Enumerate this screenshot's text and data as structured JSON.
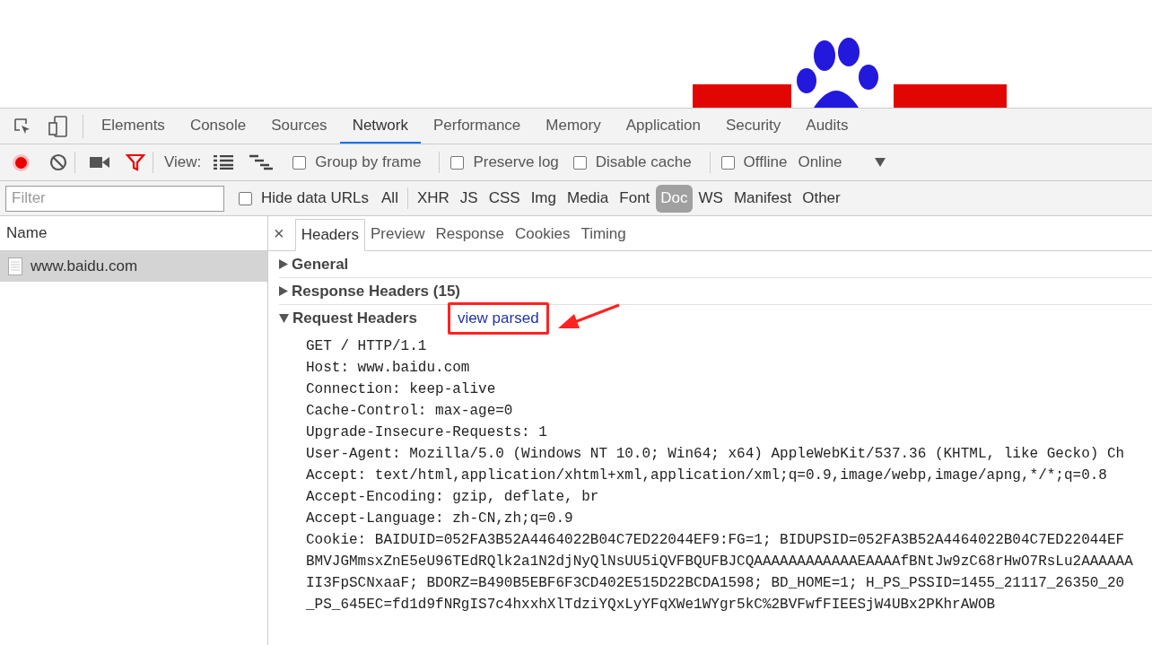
{
  "devtools_tabs": [
    {
      "label": "Elements",
      "selected": false
    },
    {
      "label": "Console",
      "selected": false
    },
    {
      "label": "Sources",
      "selected": false
    },
    {
      "label": "Network",
      "selected": true
    },
    {
      "label": "Performance",
      "selected": false
    },
    {
      "label": "Memory",
      "selected": false
    },
    {
      "label": "Application",
      "selected": false
    },
    {
      "label": "Security",
      "selected": false
    },
    {
      "label": "Audits",
      "selected": false
    }
  ],
  "toolbar": {
    "recording": true,
    "view_label": "View:",
    "options": [
      {
        "label": "Group by frame",
        "checked": false
      },
      {
        "label": "Preserve log",
        "checked": false
      },
      {
        "label": "Disable cache",
        "checked": false
      },
      {
        "label": "Offline",
        "checked": false
      }
    ],
    "throttle": "Online"
  },
  "filter_bar": {
    "placeholder": "Filter",
    "hide_data_urls": {
      "label": "Hide data URLs",
      "checked": false
    },
    "types": [
      {
        "label": "All",
        "selected": false
      },
      {
        "label": "XHR",
        "selected": false
      },
      {
        "label": "JS",
        "selected": false
      },
      {
        "label": "CSS",
        "selected": false
      },
      {
        "label": "Img",
        "selected": false
      },
      {
        "label": "Media",
        "selected": false
      },
      {
        "label": "Font",
        "selected": false
      },
      {
        "label": "Doc",
        "selected": true
      },
      {
        "label": "WS",
        "selected": false
      },
      {
        "label": "Manifest",
        "selected": false
      },
      {
        "label": "Other",
        "selected": false
      }
    ]
  },
  "requests": {
    "column": "Name",
    "rows": [
      {
        "name": "www.baidu.com",
        "selected": true
      }
    ]
  },
  "detail": {
    "close": "×",
    "tabs": [
      {
        "label": "Headers",
        "selected": true
      },
      {
        "label": "Preview",
        "selected": false
      },
      {
        "label": "Response",
        "selected": false
      },
      {
        "label": "Cookies",
        "selected": false
      },
      {
        "label": "Timing",
        "selected": false
      }
    ],
    "sections": [
      {
        "title": "General",
        "expanded": false
      },
      {
        "title": "Response Headers (15)",
        "expanded": false
      },
      {
        "title": "Request Headers",
        "expanded": true,
        "link": "view parsed"
      }
    ],
    "request_lines": [
      "GET / HTTP/1.1",
      "Host: www.baidu.com",
      "Connection: keep-alive",
      "Cache-Control: max-age=0",
      "Upgrade-Insecure-Requests: 1",
      "User-Agent: Mozilla/5.0 (Windows NT 10.0; Win64; x64) AppleWebKit/537.36 (KHTML, like Gecko) Ch",
      "Accept: text/html,application/xhtml+xml,application/xml;q=0.9,image/webp,image/apng,*/*;q=0.8",
      "Accept-Encoding: gzip, deflate, br",
      "Accept-Language: zh-CN,zh;q=0.9",
      "Cookie: BAIDUID=052FA3B52A4464022B04C7ED22044EF9:FG=1; BIDUPSID=052FA3B52A4464022B04C7ED22044EF",
      "BMVJGMmsxZnE5eU96TEdRQlk2a1N2djNyQlNsUU5iQVFBQUFBJCQAAAAAAAAAAAAEAAAAfBNtJw9zC68rHwO7RsLu2AAAAAA",
      "II3FpSCNxaaF; BDORZ=B490B5EBF6F3CD402E515D22BCDA1598; BD_HOME=1; H_PS_PSSID=1455_21117_26350_20",
      "_PS_645EC=fd1d9fNRgIS7c4hxxhXlTdziYQxLyYFqXWe1WYgr5kC%2BVFwfFIEESjW4UBx2PKhrAWOB"
    ]
  }
}
